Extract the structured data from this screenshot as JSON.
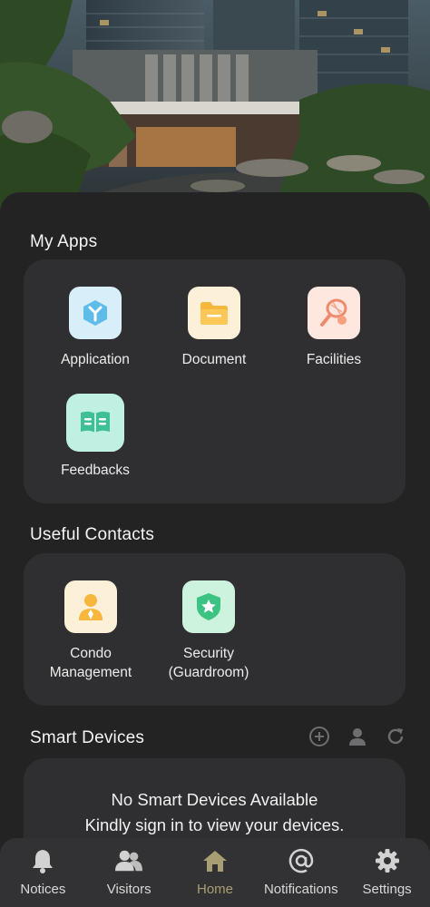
{
  "hero": {
    "image": "condominium-building-photo"
  },
  "my_apps": {
    "title": "My Apps",
    "items": [
      {
        "label": "Application",
        "icon": "application-icon"
      },
      {
        "label": "Document",
        "icon": "folder-icon"
      },
      {
        "label": "Facilities",
        "icon": "tennis-icon"
      },
      {
        "label": "Feedbacks",
        "icon": "book-icon"
      }
    ]
  },
  "contacts": {
    "title": "Useful Contacts",
    "items": [
      {
        "label_line1": "Condo",
        "label_line2": "Management",
        "icon": "manager-icon"
      },
      {
        "label_line1": "Security",
        "label_line2": "(Guardroom)",
        "icon": "shield-star-icon"
      }
    ]
  },
  "smart_devices": {
    "title": "Smart Devices",
    "empty_line1": "No Smart Devices Available",
    "empty_line2": "Kindly sign in to view your devices."
  },
  "tabbar": {
    "active": "Home",
    "tabs": [
      {
        "label": "Notices",
        "icon": "bell-icon"
      },
      {
        "label": "Visitors",
        "icon": "visitors-icon"
      },
      {
        "label": "Home",
        "icon": "home-icon"
      },
      {
        "label": "Notifications",
        "icon": "at-icon"
      },
      {
        "label": "Settings",
        "icon": "gear-icon"
      }
    ]
  },
  "colors": {
    "background": "#232324",
    "card": "#2f2f31",
    "active_tab": "#a79f73"
  }
}
